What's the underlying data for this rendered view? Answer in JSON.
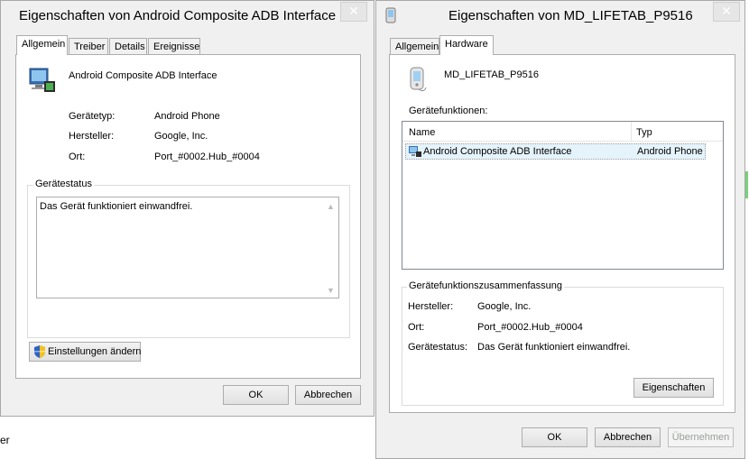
{
  "left_window": {
    "title": "Eigenschaften von Android Composite ADB Interface",
    "tabs": [
      "Allgemein",
      "Treiber",
      "Details",
      "Ereignisse"
    ],
    "device_name": "Android Composite ADB Interface",
    "props": [
      {
        "label": "Gerätetyp:",
        "value": "Android Phone"
      },
      {
        "label": "Hersteller:",
        "value": "Google, Inc."
      },
      {
        "label": "Ort:",
        "value": "Port_#0002.Hub_#0004"
      }
    ],
    "status_group": "Gerätestatus",
    "status_text": "Das Gerät funktioniert einwandfrei.",
    "change_settings": "Einstellungen ändern",
    "ok": "OK",
    "cancel": "Abbrechen"
  },
  "right_window": {
    "title": "Eigenschaften von MD_LIFETAB_P9516",
    "tabs": [
      "Allgemein",
      "Hardware"
    ],
    "device_name": "MD_LIFETAB_P9516",
    "functions_label": "Gerätefunktionen:",
    "columns": [
      "Name",
      "Typ"
    ],
    "rows": [
      {
        "name": "Android Composite ADB Interface",
        "type": "Android Phone"
      }
    ],
    "summary_group": "Gerätefunktionszusammenfassung",
    "summary": [
      {
        "label": "Hersteller:",
        "value": "Google, Inc."
      },
      {
        "label": "Ort:",
        "value": "Port_#0002.Hub_#0004"
      },
      {
        "label": "Gerätestatus:",
        "value": "Das Gerät funktioniert einwandfrei."
      }
    ],
    "properties_button": "Eigenschaften",
    "ok": "OK",
    "cancel": "Abbrechen",
    "apply": "Übernehmen"
  },
  "background_text": "er",
  "colors": {
    "window_bg": "#f0f0f0",
    "accent_green": "#7bd17b",
    "selection": "#e5f3fb"
  }
}
